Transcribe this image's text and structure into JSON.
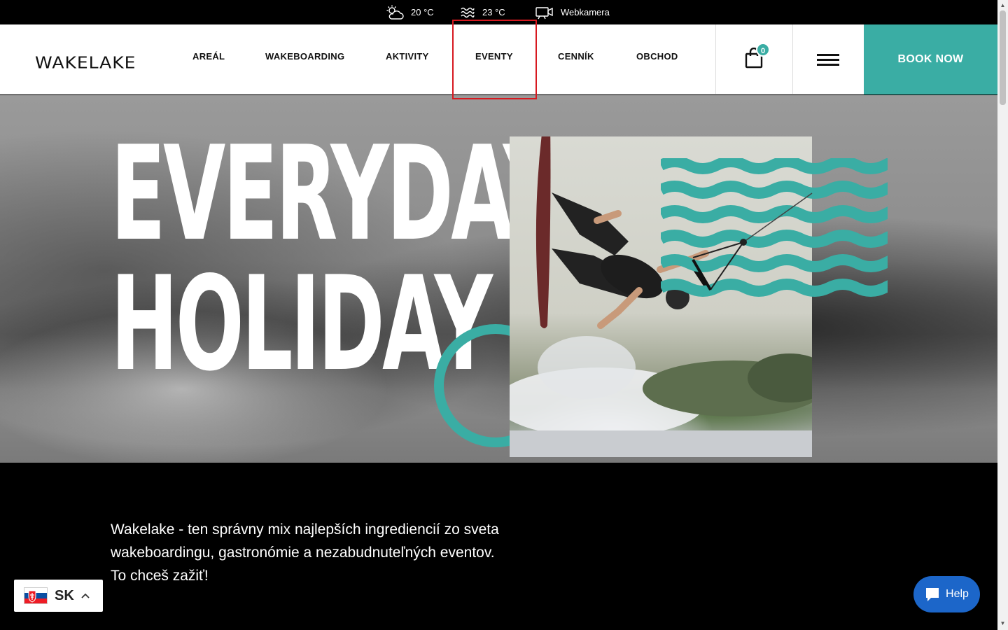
{
  "topbar": {
    "weather_icon": "cloud-sun-icon",
    "air_temp": "20 °C",
    "water_icon": "water-waves-icon",
    "water_temp": "23 °C",
    "webcam_icon": "video-camera-icon",
    "webcam_label": "Webkamera"
  },
  "header": {
    "logo": "WAKELAKE",
    "nav": [
      "AREÁL",
      "WAKEBOARDING",
      "AKTIVITY",
      "EVENTY",
      "CENNÍK",
      "OBCHOD"
    ],
    "cart_icon": "shopping-bag-icon",
    "cart_count": "0",
    "menu_icon": "hamburger-menu-icon",
    "book_label": "BOOK NOW"
  },
  "hero": {
    "headline_line1": "EVERYDAY",
    "headline_line2": "HOLIDAY"
  },
  "intro": {
    "tagline": "Wakelake - ten správny mix najlepších ingrediencií zo sveta wakeboardingu, gastronómie a nezabudnuteľných eventov. To chceš zažiť!"
  },
  "language": {
    "flag_icon": "slovakia-flag-icon",
    "code": "SK",
    "caret_icon": "chevron-up-icon"
  },
  "help": {
    "icon": "chat-bubble-icon",
    "label": "Help"
  },
  "colors": {
    "accent": "#3aada4",
    "help_button": "#1c66c9",
    "highlight_box": "#d71920"
  }
}
